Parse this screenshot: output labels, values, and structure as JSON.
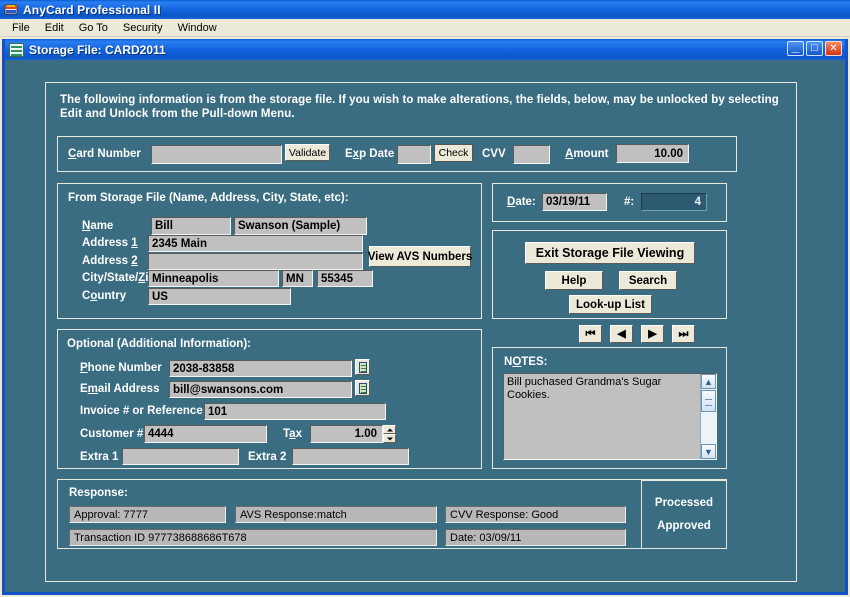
{
  "app": {
    "title": "AnyCard Professional II",
    "icon": "card-app-icon",
    "menu": [
      "File",
      "Edit",
      "Go To",
      "Security",
      "Window"
    ]
  },
  "child_window": {
    "title": "Storage File: CARD2011",
    "icon": "storage-file-icon",
    "buttons": {
      "minimize": "_",
      "maximize": "□",
      "close": "✕"
    }
  },
  "intro": "The following information is from the storage file.  If you wish to make alterations, the fields, below, may be unlocked by selecting Edit and Unlock from the Pull-down Menu.",
  "card_row": {
    "card_number_label": "Card Number",
    "card_number_value": "",
    "validate_button": "Validate",
    "exp_date_label": "Exp Date",
    "exp_date_value": "",
    "check_button": "Check",
    "cvv_label": "CVV",
    "cvv_value": "",
    "amount_label": "Amount",
    "amount_value": "10.00"
  },
  "storage": {
    "title": "From Storage File (Name, Address, City, State, etc):",
    "name_label": "Name",
    "first_name": "Bill",
    "last_name": "Swanson (Sample)",
    "address1_label": "Address 1",
    "address1": "2345 Main",
    "address2_label": "Address 2",
    "address2": "",
    "citystatezip_label": "City/State/Zip",
    "city": "Minneapolis",
    "state": "MN",
    "zip": "55345",
    "country_label": "Country",
    "country": "US",
    "avs_button": "View AVS Numbers"
  },
  "optional": {
    "title": "Optional (Additional Information):",
    "phone_label": "Phone Number",
    "phone": "2038-83858",
    "email_label": "Email Address",
    "email": "bill@swansons.com",
    "invoice_label": "Invoice # or Reference",
    "invoice": "101",
    "customer_label": "Customer #",
    "customer": "4444",
    "tax_label": "Tax",
    "tax": "1.00",
    "extra1_label": "Extra 1",
    "extra1": "",
    "extra2_label": "Extra 2",
    "extra2": ""
  },
  "record": {
    "date_label": "Date:",
    "date_value": "03/19/11",
    "num_label": "#:",
    "num_value": "4"
  },
  "actions": {
    "exit": "Exit  Storage File Viewing",
    "help": "Help",
    "search": "Search",
    "lookup": "Look-up List",
    "nav_first": "⏮",
    "nav_prev": "◀",
    "nav_next": "▶",
    "nav_last": "⏭"
  },
  "notes": {
    "title": "NOTES:",
    "text": "Bill puchased Grandma's Sugar Cookies."
  },
  "response": {
    "title": "Response:",
    "approval": "Approval: 7777",
    "avs": "AVS Response:match",
    "cvv": "CVV Response: Good",
    "transaction": "Transaction ID 977738688686T678",
    "date": "Date: 03/09/11",
    "status_line1": "Processed",
    "status_line2": "Approved"
  },
  "colors": {
    "window_bg": "#3a6d82",
    "titlebar_blue": "#1464e0",
    "field_gray": "#c0c0c0",
    "button_face": "#ece9d8",
    "close_red": "#d4331a",
    "dark_field": "#2d5a70"
  }
}
